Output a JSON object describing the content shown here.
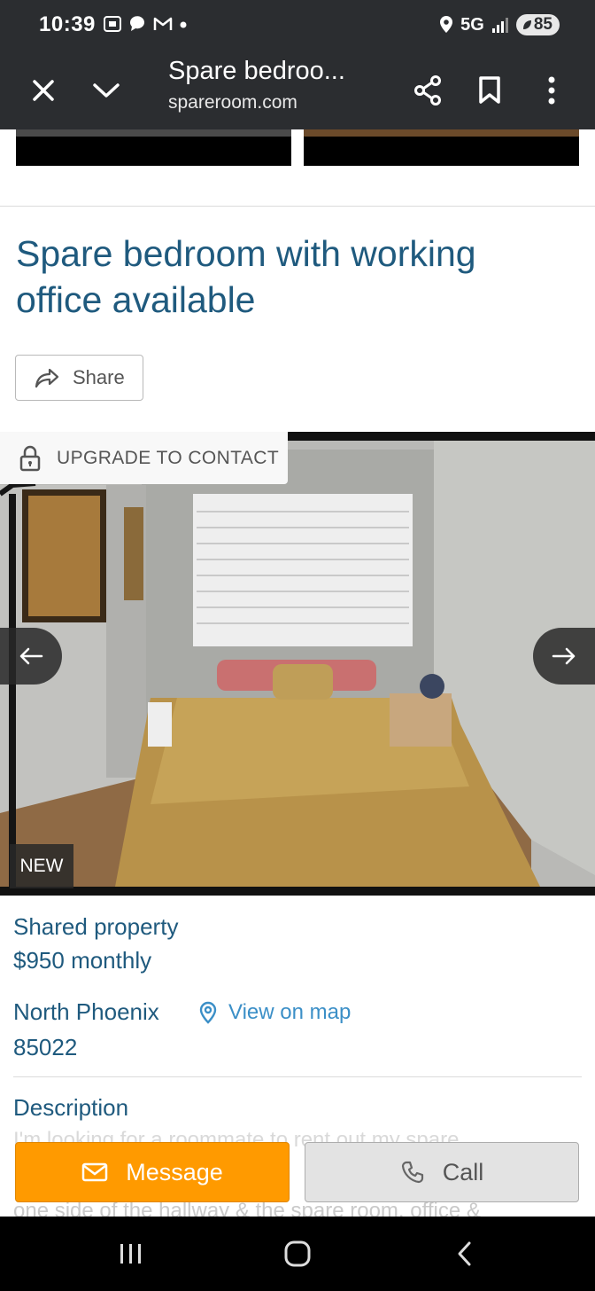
{
  "status": {
    "time": "10:39",
    "network": "5G",
    "battery": "85"
  },
  "browser": {
    "title": "Spare bedroo...",
    "url": "spareroom.com"
  },
  "listing": {
    "title": "Spare bedroom with working office available",
    "share_label": "Share",
    "upgrade_label": "UPGRADE TO CONTACT",
    "new_badge": "NEW",
    "property_type": "Shared property",
    "price": "$950 monthly",
    "area": "North Phoenix",
    "map_link": "View on map",
    "zip": "85022",
    "description_heading": "Description",
    "description_line1": "I'm looking for a roommate to rent out my spare",
    "description_line2": "one side of the hallway & the spare room, office &"
  },
  "actions": {
    "message_label": "Message",
    "call_label": "Call"
  },
  "colors": {
    "heading_blue": "#1f5a7e",
    "link_blue": "#3b8fc7",
    "message_orange": "#ff9a00",
    "browser_bar": "#2b2d30"
  }
}
